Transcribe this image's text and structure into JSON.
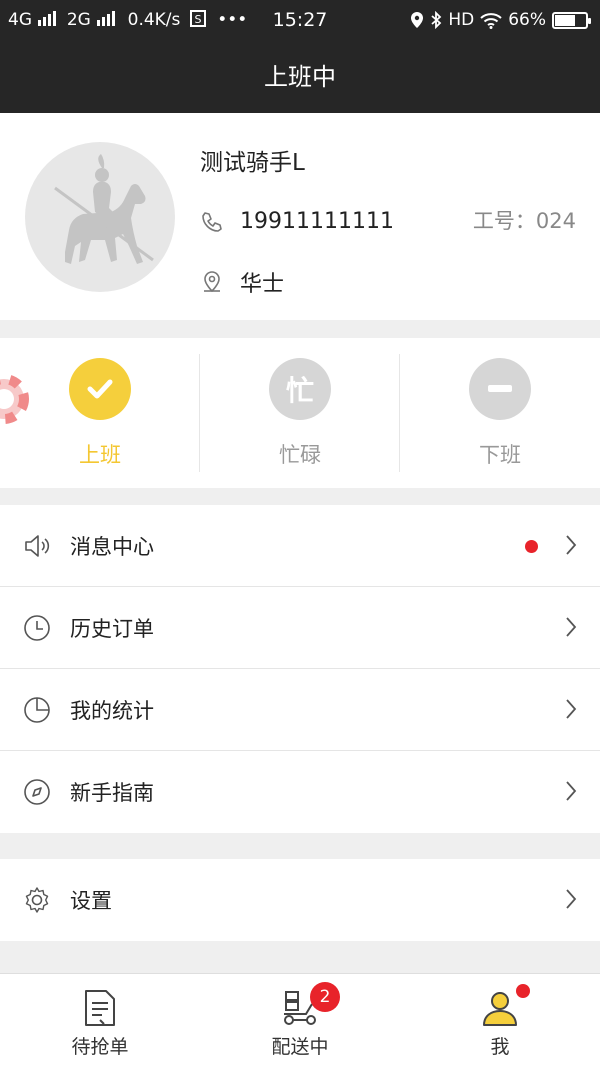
{
  "status_bar": {
    "network_left": "4G",
    "network_right": "2G",
    "speed": "0.4K/s",
    "more": "•••",
    "time": "15:27",
    "hd": "HD",
    "battery": "66%",
    "battery_level": 0.66
  },
  "header": {
    "title": "上班中"
  },
  "profile": {
    "name": "测试骑手L",
    "phone": "19911111111",
    "location": "华士",
    "employee_no": "工号：024"
  },
  "work_status": {
    "items": [
      {
        "label": "上班",
        "icon": "check-icon",
        "active": true
      },
      {
        "label": "忙碌",
        "icon_text": "忙",
        "active": false
      },
      {
        "label": "下班",
        "icon": "minus-icon",
        "active": false
      }
    ]
  },
  "menu": {
    "items": [
      {
        "label": "消息中心",
        "icon": "speaker-icon",
        "has_dot": true
      },
      {
        "label": "历史订单",
        "icon": "clock-icon",
        "has_dot": false
      },
      {
        "label": "我的统计",
        "icon": "pie-chart-icon",
        "has_dot": false
      },
      {
        "label": "新手指南",
        "icon": "compass-icon",
        "has_dot": false
      }
    ],
    "settings": {
      "label": "设置",
      "icon": "gear-icon"
    }
  },
  "tabbar": {
    "items": [
      {
        "label": "待抢单",
        "icon": "document-icon"
      },
      {
        "label": "配送中",
        "icon": "scooter-icon",
        "badge": "2"
      },
      {
        "label": "我",
        "icon": "user-icon",
        "dot": true
      }
    ]
  },
  "colors": {
    "header_bg": "#262626",
    "accent_yellow": "#f5cf3c",
    "badge_red": "#e8232a"
  }
}
